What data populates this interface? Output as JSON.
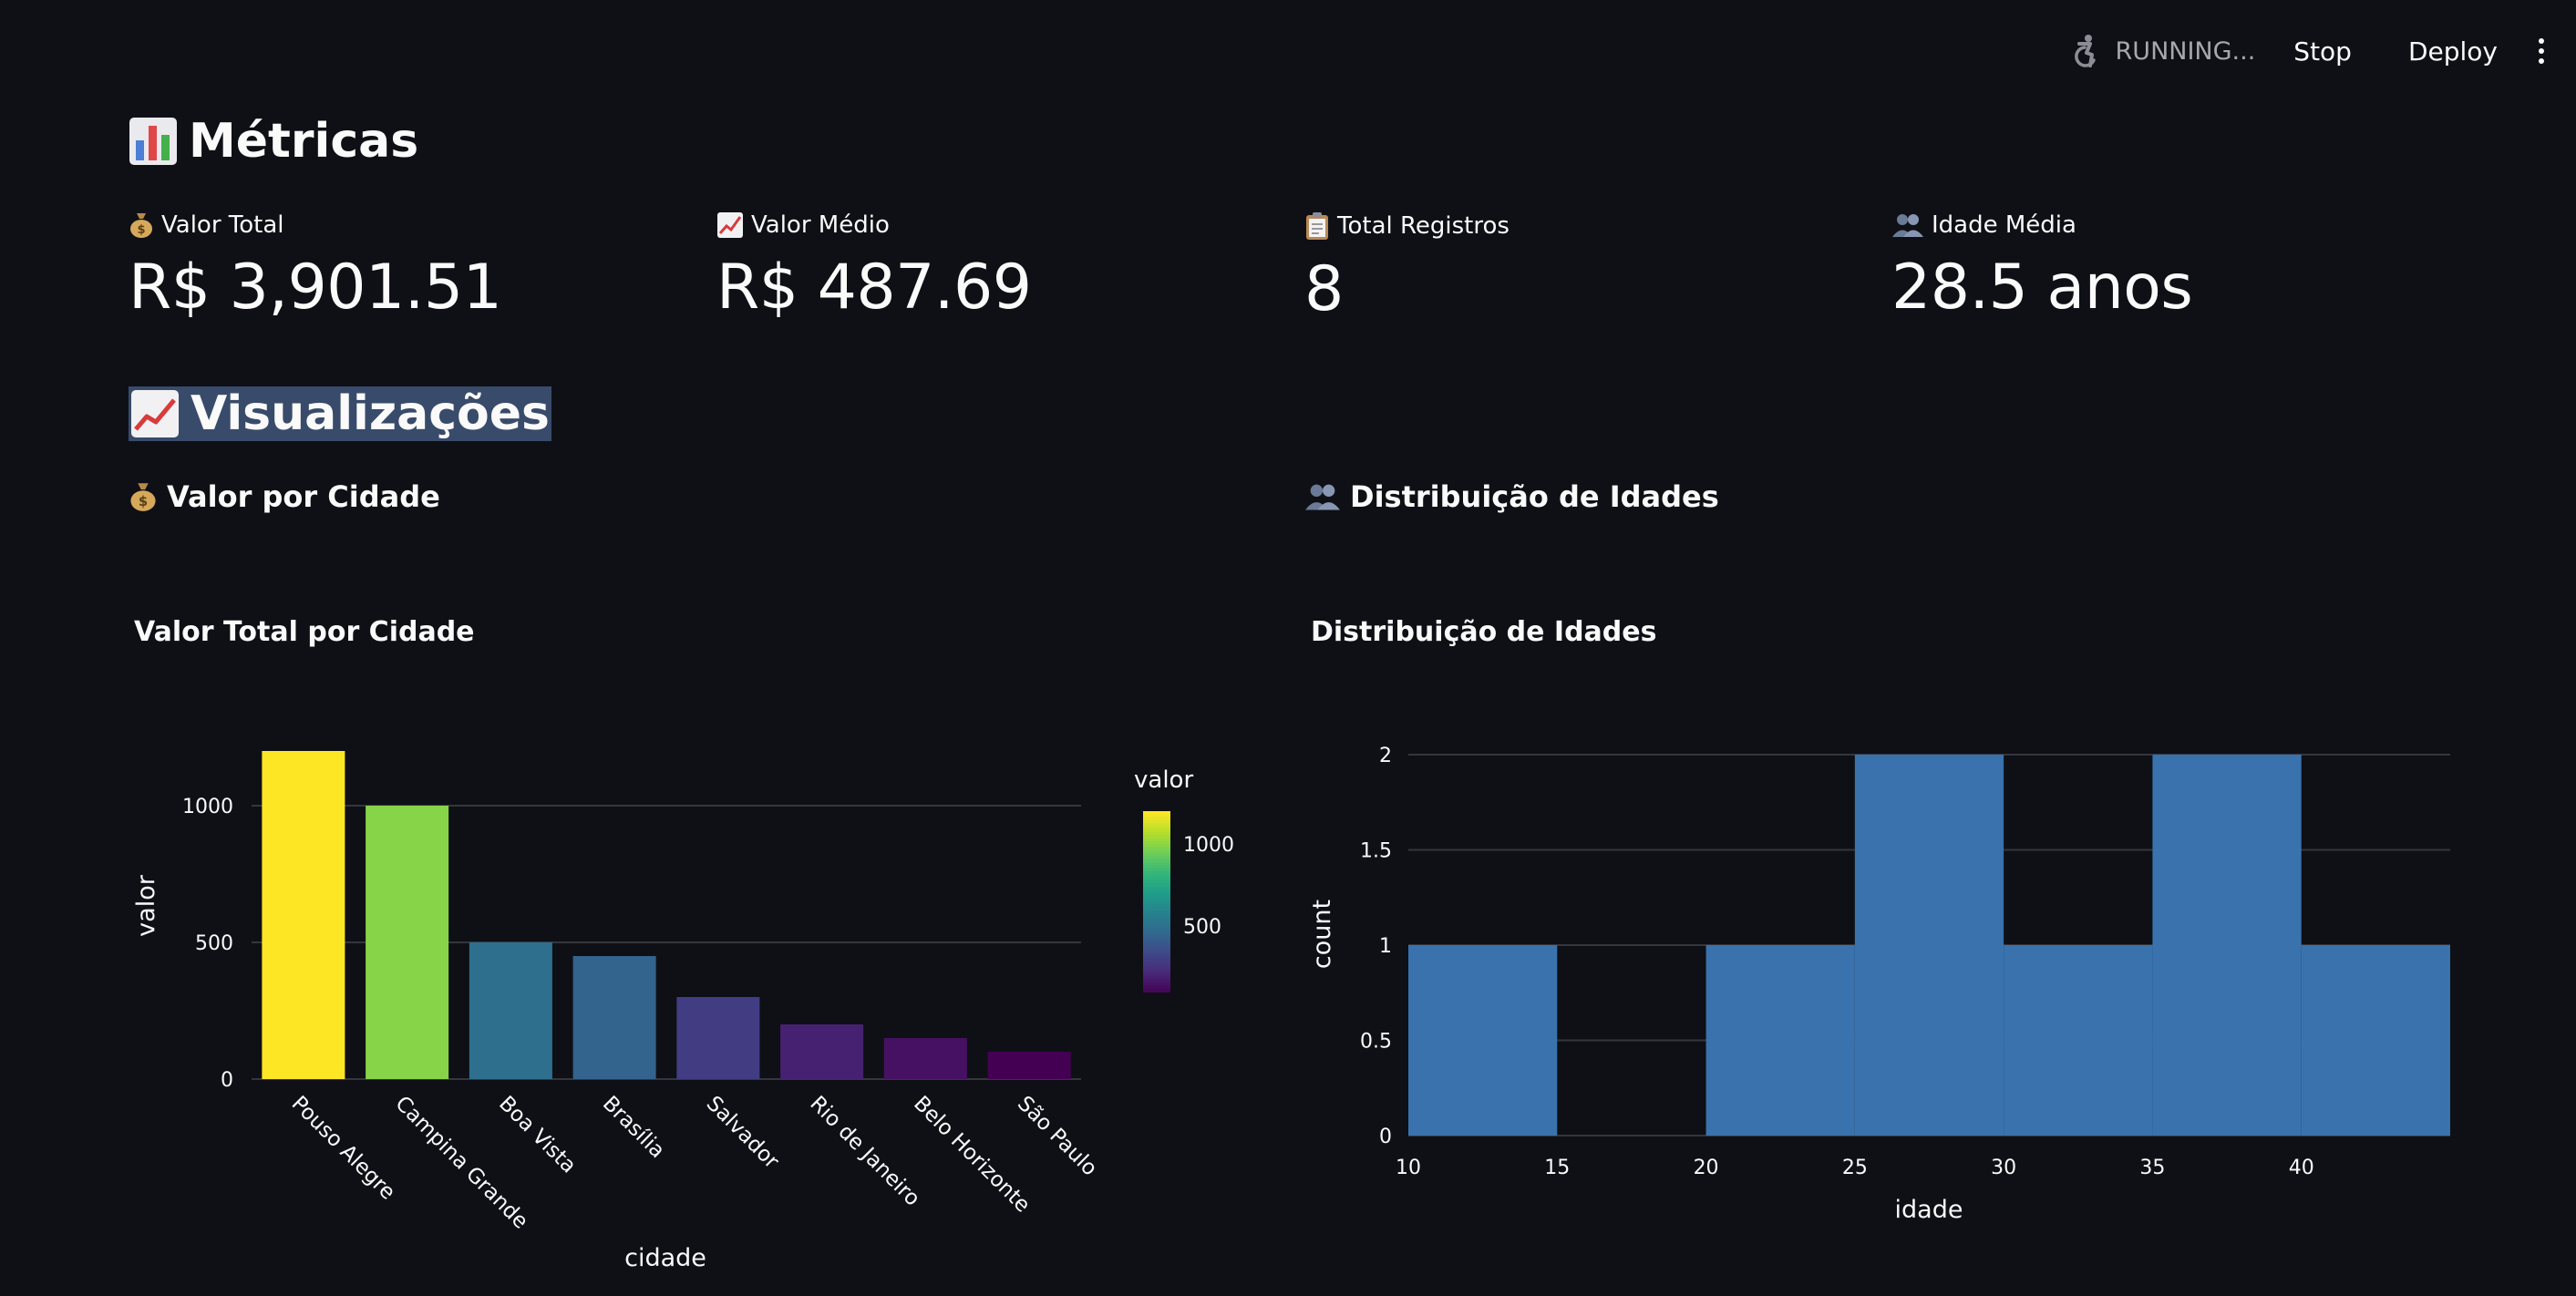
{
  "header": {
    "status": "RUNNING...",
    "stop_label": "Stop",
    "deploy_label": "Deploy"
  },
  "sections": {
    "metricas_title": "Métricas",
    "visualizacoes_title": "Visualizações"
  },
  "metrics": [
    {
      "icon": "money-bag-icon",
      "label": "Valor Total",
      "value": "R$ 3,901.51"
    },
    {
      "icon": "chart-increasing-icon",
      "label": "Valor Médio",
      "value": "R$ 487.69"
    },
    {
      "icon": "clipboard-icon",
      "label": "Total Registros",
      "value": "8"
    },
    {
      "icon": "people-icon",
      "label": "Idade Média",
      "value": "28.5 anos"
    }
  ],
  "subsections": {
    "left": "Valor por Cidade",
    "right": "Distribuição de Idades"
  },
  "colors": {
    "background": "#0f1016",
    "selection_highlight": "#394b6b",
    "histogram_bar": "#3a72ad",
    "gridline": "#33363f"
  },
  "chart_data": [
    {
      "type": "bar",
      "title": "Valor Total por Cidade",
      "xlabel": "cidade",
      "ylabel": "valor",
      "categories": [
        "Pouso Alegre",
        "Campina Grande",
        "Boa Vista",
        "Brasília",
        "Salvador",
        "Rio de Janeiro",
        "Belo Horizonte",
        "São Paulo"
      ],
      "values": [
        1200,
        1000,
        500,
        450,
        300,
        200,
        150,
        100
      ],
      "ylim": [
        0,
        1200
      ],
      "yticks": [
        0,
        500,
        1000
      ],
      "colorscale": "viridis",
      "colorbar": {
        "title": "valor",
        "ticks": [
          500,
          1000
        ],
        "range": [
          100,
          1200
        ]
      },
      "grid": true
    },
    {
      "type": "bar",
      "title": "Distribuição de Idades",
      "xlabel": "idade",
      "ylabel": "count",
      "bins": [
        {
          "start": 10,
          "end": 15,
          "count": 1
        },
        {
          "start": 15,
          "end": 20,
          "count": 0
        },
        {
          "start": 20,
          "end": 25,
          "count": 1
        },
        {
          "start": 25,
          "end": 30,
          "count": 2
        },
        {
          "start": 30,
          "end": 35,
          "count": 1
        },
        {
          "start": 35,
          "end": 40,
          "count": 2
        },
        {
          "start": 40,
          "end": 45,
          "count": 1
        }
      ],
      "xticks": [
        10,
        15,
        20,
        25,
        30,
        35,
        40
      ],
      "yticks": [
        0,
        0.5,
        1,
        1.5,
        2
      ],
      "ylim": [
        0,
        2
      ],
      "grid": true
    }
  ]
}
